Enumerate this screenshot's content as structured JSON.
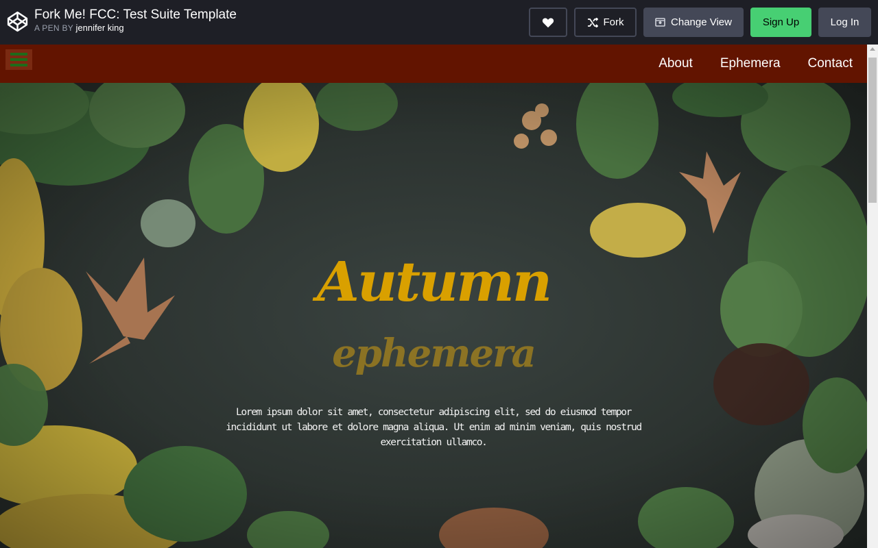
{
  "codepen": {
    "title": "Fork Me! FCC: Test Suite Template",
    "byline_prefix": "A PEN BY",
    "author": "jennifer king",
    "buttons": {
      "fork": "Fork",
      "change_view": "Change View",
      "sign_up": "Sign Up",
      "log_in": "Log In"
    },
    "icons": [
      "codepen-logo-icon",
      "heart-icon",
      "fork-icon",
      "change-view-icon"
    ]
  },
  "site": {
    "nav": {
      "links": [
        "About",
        "Ephemera",
        "Contact"
      ],
      "background": "#621400"
    },
    "hero": {
      "title": "Autumn",
      "subtitle": "ephemera",
      "text": "Lorem ipsum dolor sit amet, consectetur adipiscing elit, sed do eiusmod tempor incididunt ut labore et dolore magna aliqua. Ut enim ad minim veniam, quis nostrud exercitation ullamco.",
      "title_color": "#d9a000"
    }
  },
  "colors": {
    "codepen_bar": "#1e1f26",
    "signup_green": "#47cf73",
    "button_gray": "#444857"
  }
}
